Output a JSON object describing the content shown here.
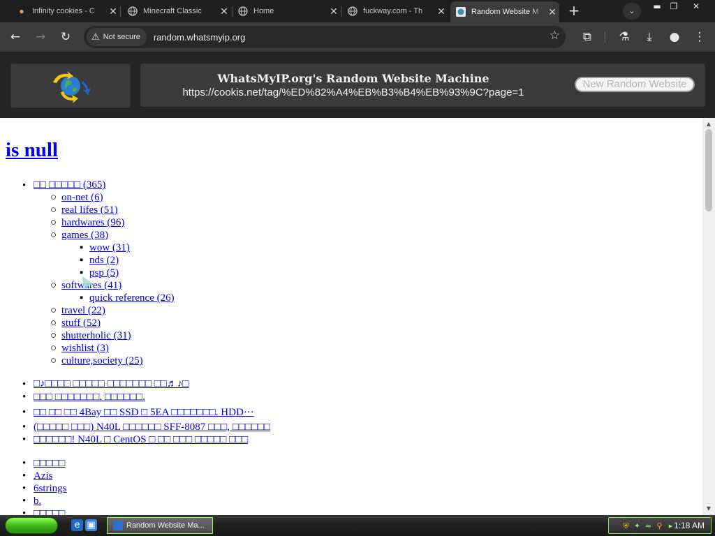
{
  "browser": {
    "tabs": [
      {
        "title": "Infinity cookies - C",
        "favicon": "cookie-icon",
        "active": false
      },
      {
        "title": "Minecraft Classic",
        "favicon": "globe-icon",
        "active": false
      },
      {
        "title": "Home",
        "favicon": "globe-icon",
        "active": false
      },
      {
        "title": "fuckway.com - Th",
        "favicon": "globe-icon",
        "active": false
      },
      {
        "title": "Random Website M",
        "favicon": "whatsmyip-icon",
        "active": true
      }
    ],
    "close_glyph": "✕",
    "new_tab_glyph": "+",
    "security_label": "Not secure",
    "url": "random.whatsmyip.org"
  },
  "machine": {
    "title": "WhatsMyIP.org's Random Website Machine",
    "current_url": "https://cookis.net/tag/%ED%82%A4%EB%B3%B4%EB%93%9C?page=1",
    "button_label": "New Random Website"
  },
  "page": {
    "heading": "is null",
    "categories": [
      {
        "label": "□□ □□□□□ (365)",
        "level": 0
      },
      {
        "label": "on-net (6)",
        "level": 1
      },
      {
        "label": "real lifes (51)",
        "level": 1
      },
      {
        "label": "hardwares (96)",
        "level": 1
      },
      {
        "label": "games (38)",
        "level": 1
      },
      {
        "label": "wow (31)",
        "level": 2
      },
      {
        "label": "nds (2)",
        "level": 2
      },
      {
        "label": "psp (5)",
        "level": 2
      },
      {
        "label": "softwares (41)",
        "level": 1
      },
      {
        "label": "quick reference (26)",
        "level": 2
      },
      {
        "label": "travel (22)",
        "level": 1
      },
      {
        "label": "stuff (52)",
        "level": 1
      },
      {
        "label": "shutterholic (31)",
        "level": 1
      },
      {
        "label": "wishlist (3)",
        "level": 1
      },
      {
        "label": "culture,society (25)",
        "level": 1
      }
    ],
    "recent_posts": [
      "□♪□□□□ □□□□□ □□□□□□□ □□♬♪□",
      "□□□ □□□□□□□. □□□□□□.",
      "□□ □□ □□ 4Bay □□ SSD □ 5EA □□□□□□□. HDD···",
      "(□□□□□ □□□) N40L □□□□□□ SFF-8087 □□□, □□□□□□",
      "□□□□□□! N40L □ CentOS □ □□ □□□ □□□□□ □□□"
    ],
    "links": [
      "□□□□□",
      "Azis",
      "6strings",
      "b.",
      "□□□□□"
    ]
  },
  "taskbar": {
    "task_label": "Random Website Ma...",
    "clock": "1:18 AM"
  },
  "colors": {
    "link": "#0000ee",
    "header_bg": "#242424",
    "box_bg": "#3b3b3b",
    "start_green": "#3fb61c"
  }
}
